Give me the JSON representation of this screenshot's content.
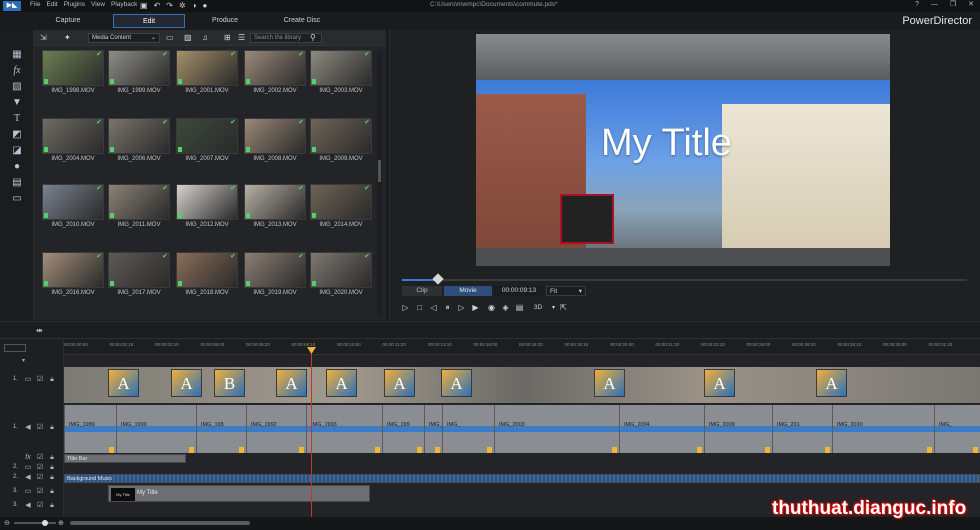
{
  "titlebar": {
    "menu": [
      "File",
      "Edit",
      "Plugins",
      "View",
      "Playback"
    ],
    "path": "C:\\Users\\mwmpc\\Documents\\commute.pds*",
    "window_controls": [
      "?",
      "—",
      "❐",
      "✕"
    ]
  },
  "modes": {
    "capture": "Capture",
    "edit": "Edit",
    "produce": "Produce",
    "create_disc": "Create Disc"
  },
  "brand": "PowerDirector",
  "library": {
    "media_select": "Media Content",
    "search_placeholder": "Search the library",
    "items": [
      "IMG_1998.MOV",
      "IMG_1999.MOV",
      "IMG_2001.MOV",
      "IMG_2002.MOV",
      "IMG_2003.MOV",
      "IMG_2004.MOV",
      "IMG_2006.MOV",
      "IMG_2007.MOV",
      "IMG_2008.MOV",
      "IMG_2009.MOV",
      "IMG_2010.MOV",
      "IMG_2011.MOV",
      "IMG_2012.MOV",
      "IMG_2013.MOV",
      "IMG_2014.MOV",
      "IMG_2016.MOV",
      "IMG_2017.MOV",
      "IMG_2018.MOV",
      "IMG_2019.MOV",
      "IMG_2020.MOV"
    ],
    "colors": [
      "#6a7f52",
      "#8e8d86",
      "#a4916a",
      "#9a8a7a",
      "#8c8a80",
      "#6e6c64",
      "#7a756c",
      "#3d4a3c",
      "#9b8877",
      "#6f6558",
      "#7a8290",
      "#8a8276",
      "#d6d2cc",
      "#b7b0a4",
      "#6e6456",
      "#a38e7a",
      "#5e5a55",
      "#8a6e5a",
      "#8b7f74",
      "#7f7870"
    ]
  },
  "preview": {
    "title_text": "My Title",
    "clip_label": "Clip",
    "movie_label": "Movie",
    "timecode": "00:00:09:13",
    "fit_label": "Fit",
    "threed_label": "3D"
  },
  "timeline": {
    "ruler": [
      "00:00:00:00",
      "00:00:01:15",
      "00:00:02:10",
      "00:00:05:00",
      "00:00:06:20",
      "00:00:08:10",
      "00:00:10:00",
      "00:00:11:20",
      "00:00:13:10",
      "00:00:15:00",
      "00:00:16:20",
      "00:00:18:10",
      "00:00:20:00",
      "00:00:21:20",
      "00:00:23:10",
      "00:00:25:00",
      "00:00:26:20",
      "00:00:28:10",
      "00:00:30:00",
      "00:00:31:20"
    ],
    "track_numbers": [
      "1.",
      "1.",
      "2.",
      "2.",
      "3.",
      "3."
    ],
    "transitions": [
      "A",
      "A",
      "B",
      "A",
      "A",
      "A",
      "A",
      "A",
      "A",
      "A"
    ],
    "audio_clips": [
      "IMG_1989",
      "IMG_1990",
      "IMG_198",
      "IMG_1992",
      "IMG_1993",
      "IMG_199",
      "IMG_2001",
      "IMG_",
      "IMG_2003",
      "IMG_2004",
      "IMG_2009",
      "IMG_201",
      "IMG_2010",
      "IMG_"
    ],
    "title_clip": "Title Bar",
    "bg_clip": "Background Music",
    "mytitle_clip": "My Title",
    "mytitle_thumb": "My Title"
  },
  "watermark": "thuthuat.dianguc.info"
}
